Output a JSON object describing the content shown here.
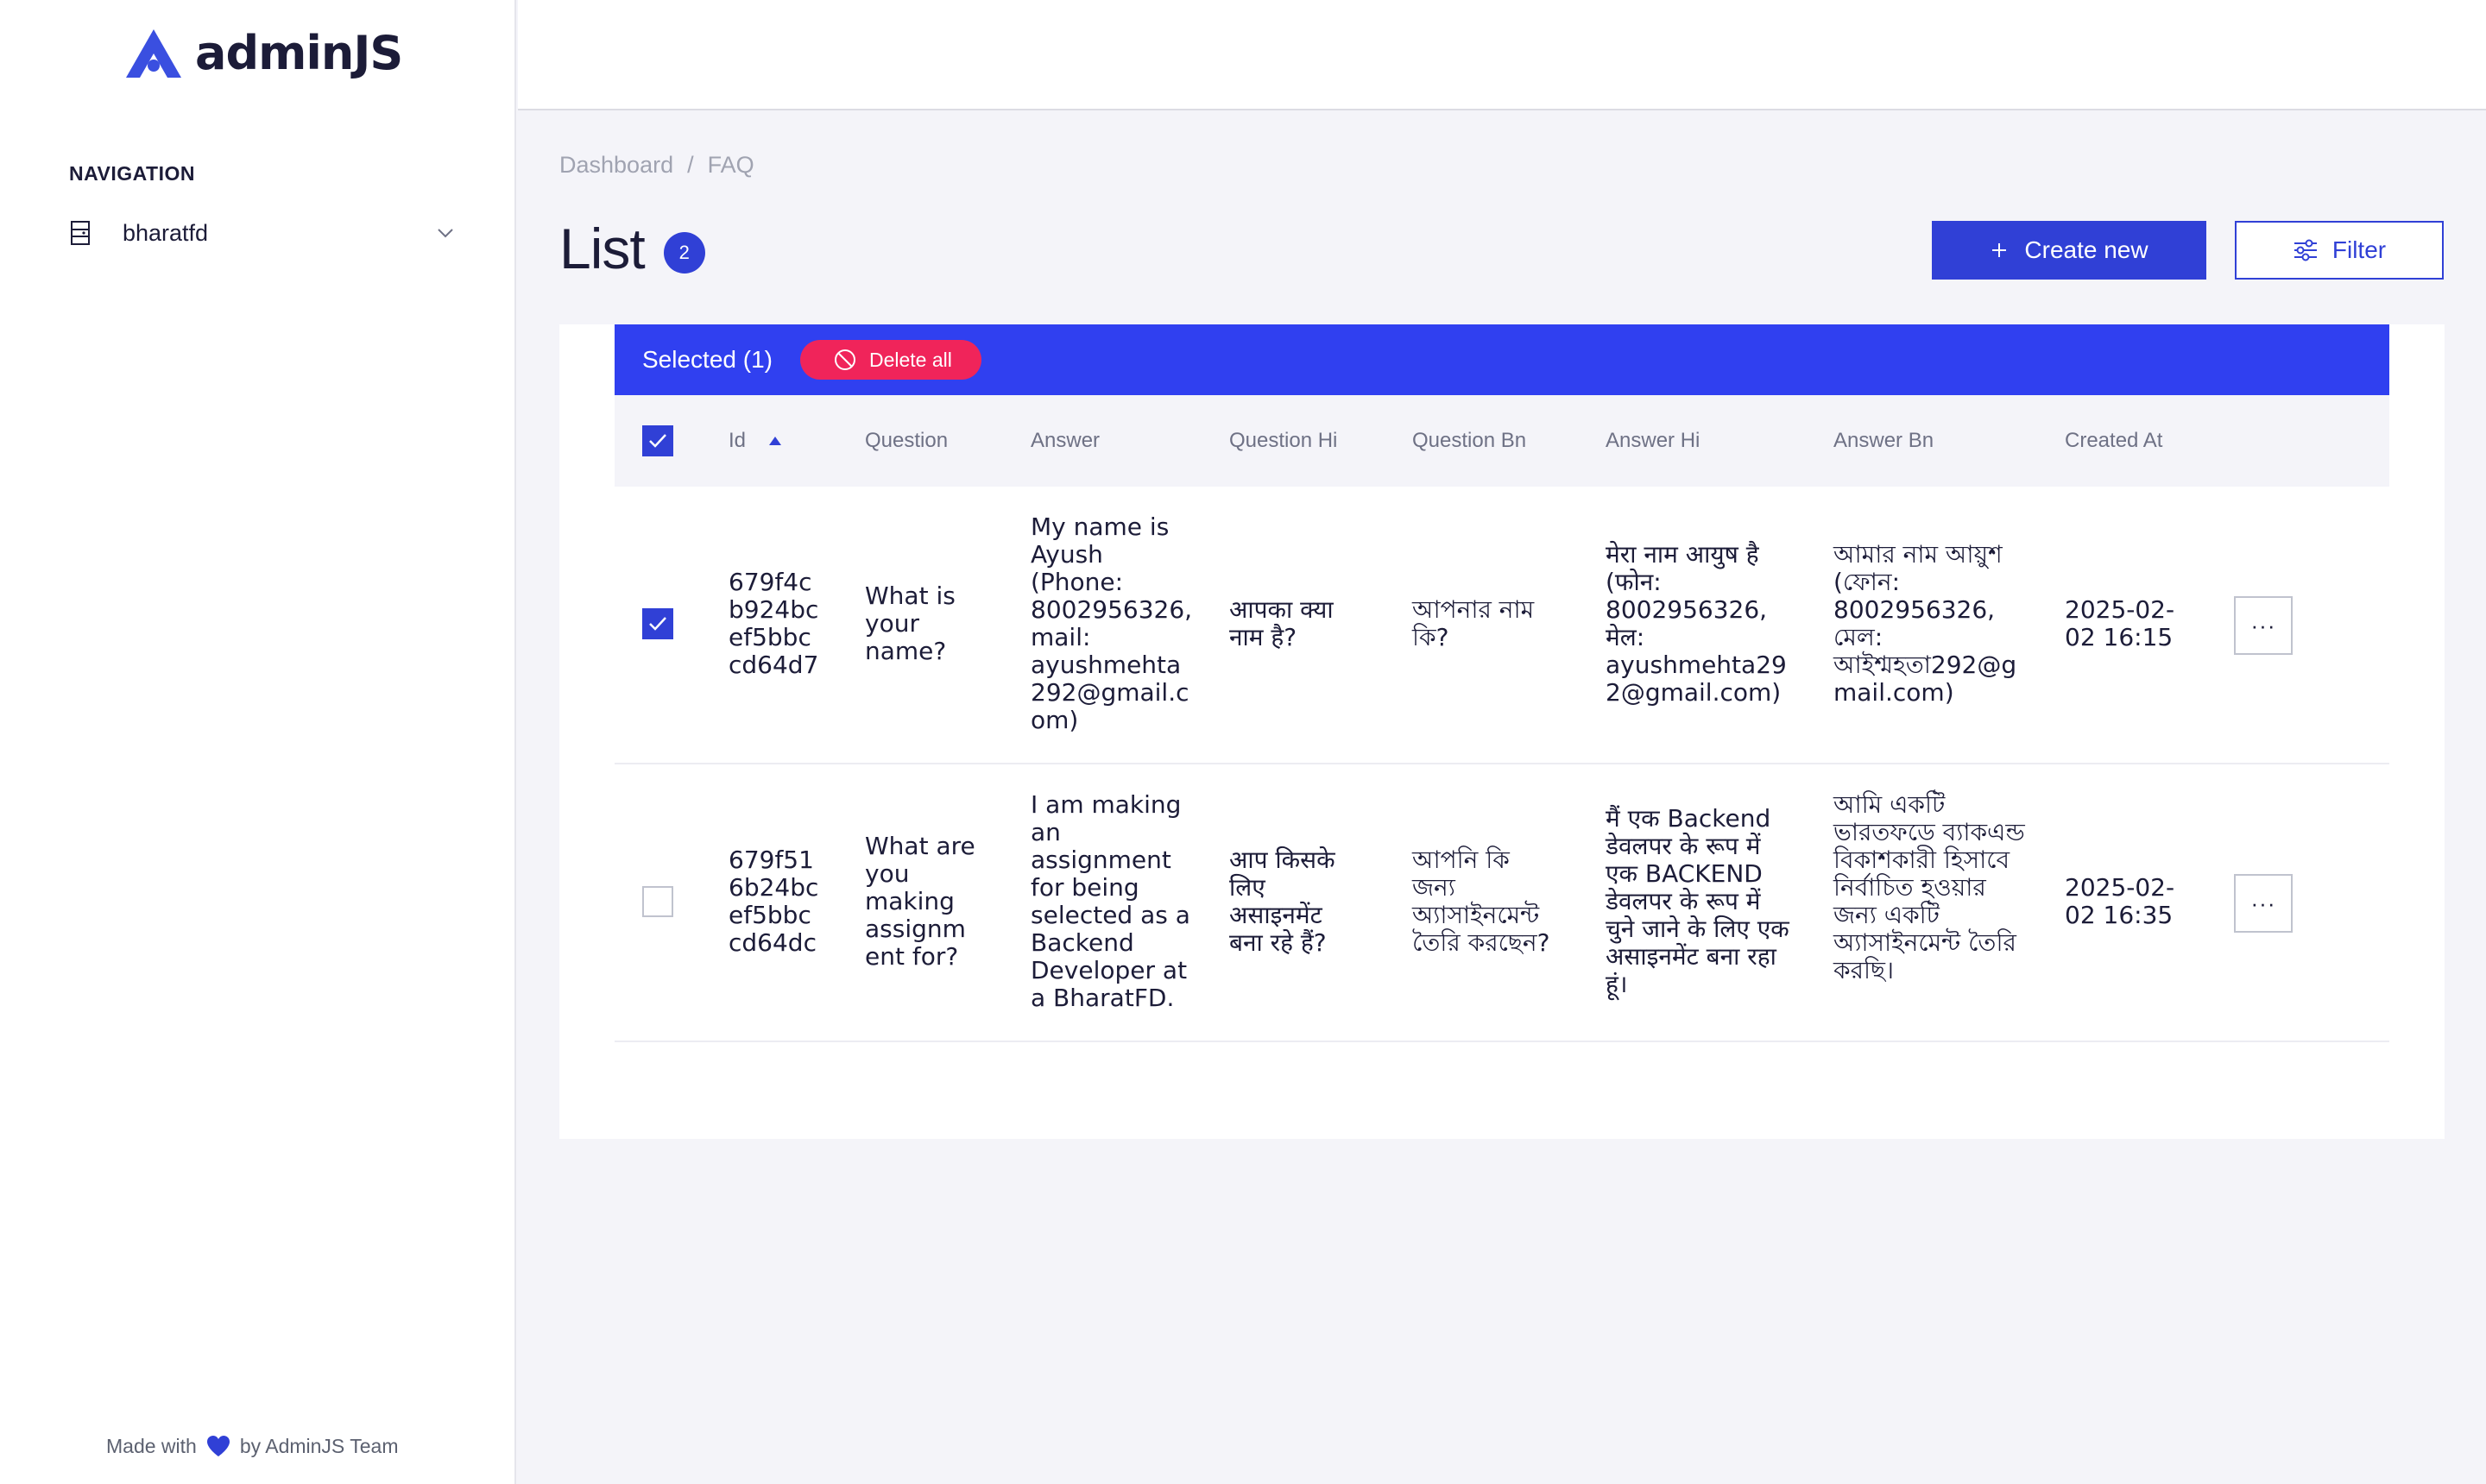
{
  "app": {
    "logo_text": "adminJS"
  },
  "sidebar": {
    "nav_title": "NAVIGATION",
    "items": [
      {
        "label": "bharatfd",
        "icon": "database-icon"
      }
    ],
    "footer": {
      "prefix": "Made with",
      "suffix": "by AdminJS Team"
    }
  },
  "breadcrumb": {
    "items": [
      "Dashboard",
      "FAQ"
    ],
    "separator": "/"
  },
  "page": {
    "title": "List",
    "count": "2"
  },
  "actions": {
    "create_label": "Create new",
    "filter_label": "Filter"
  },
  "selection": {
    "label": "Selected (1)",
    "delete_label": "Delete all"
  },
  "table": {
    "headers": [
      "Id",
      "Question",
      "Answer",
      "Question Hi",
      "Question Bn",
      "Answer Hi",
      "Answer Bn",
      "Created At"
    ],
    "sort_column": "Id",
    "rows": [
      {
        "selected": true,
        "id": "679f4cb924bcef5bbccd64d7",
        "question": "What is your name?",
        "answer": "My name is Ayush (Phone: 8002956326, mail: ayushmehta292@gmail.com)",
        "question_hi": "आपका क्या नाम है?",
        "question_bn": "আপনার নাম কি?",
        "answer_hi": "मेरा नाम आयुष है (फोन: 8002956326, मेल: ayushmehta292@gmail.com)",
        "answer_bn": "আমার নাম আয়ুশ (ফোন: 8002956326, মেল: আইশ্মহতা292@gmail.com)",
        "created_at": "2025-02-02 16:15"
      },
      {
        "selected": false,
        "id": "679f516b24bcef5bbccd64dc",
        "question": "What are you making assignment for?",
        "answer": "I am making an assignment for being selected as a Backend Developer at a BharatFD.",
        "question_hi": "आप किसके लिए असाइनमेंट बना रहे हैं?",
        "question_bn": "আপনি কি জন্য অ্যাসাইনমেন্ট তৈরি করছেন?",
        "answer_hi": "मैं एक Backend डेवलपर के रूप में एक BACKEND डेवलपर के रूप में चुने जाने के लिए एक असाइनमेंट बना रहा हूं।",
        "answer_bn": "আমি একটি ভারতফডে ব্যাকএন্ড বিকাশকারী হিসাবে নির্বাচিত হওয়ার জন্য একটি অ্যাসাইনমেন্ট তৈরি করছি।",
        "created_at": "2025-02-02 16:35"
      }
    ],
    "row_action_label": "···"
  },
  "colors": {
    "primary": "#3040d6",
    "selection_bar": "#3040f0",
    "danger": "#f0245a",
    "background": "#f4f4f9"
  }
}
